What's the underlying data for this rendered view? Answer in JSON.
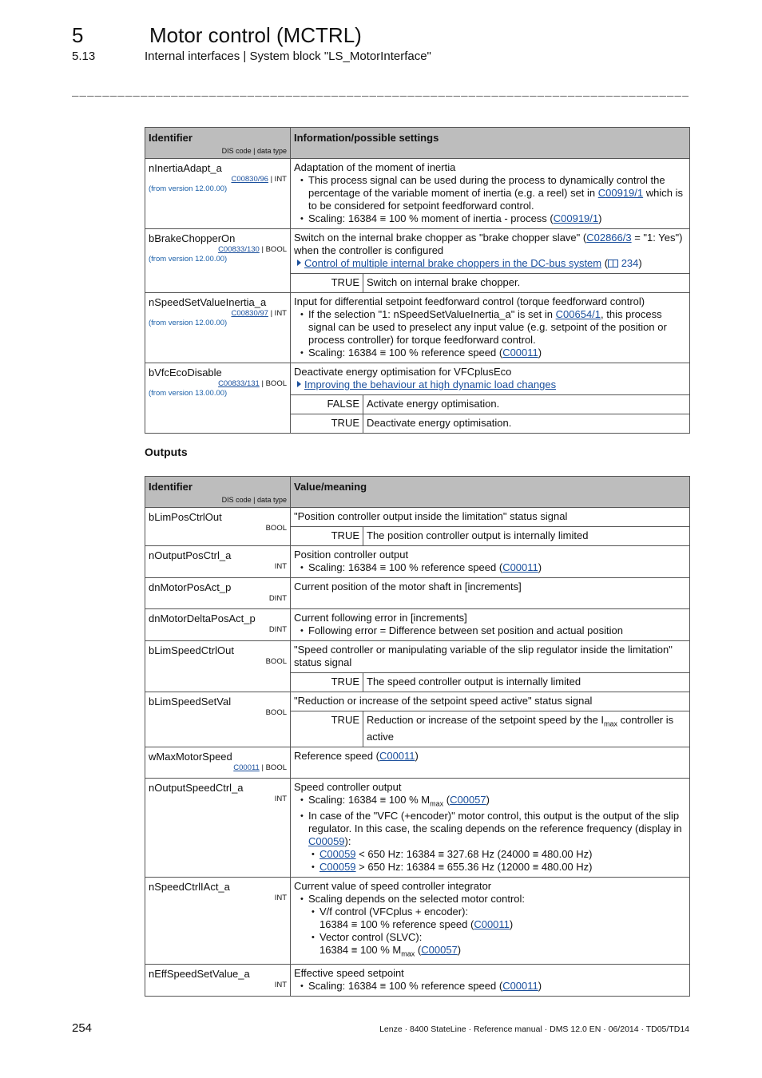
{
  "header": {
    "chapter_number": "5",
    "chapter_title": "Motor control (MCTRL)",
    "section_number": "5.13",
    "section_title": "Internal interfaces | System block \"LS_MotorInterface\"",
    "rule": "_______________________________________________________________________________________________"
  },
  "inputs_table": {
    "col_identifier": "Identifier",
    "col_identifier_sub": "DIS code | data type",
    "col_info": "Information/possible settings",
    "rows": [
      {
        "name": "nInertiaAdapt_a",
        "code": "C00830/96",
        "type": " | INT",
        "version": "(from version 12.00.00)",
        "desc": "Adaptation of the moment of inertia",
        "b1_pre": "This process signal can be used during the process to dynamically control the percentage of the variable moment of inertia (e.g. a reel) set in ",
        "b1_link": "C00919/1",
        "b1_post": " which is to be considered for setpoint feedforward control.",
        "b2_pre": "Scaling: 16384 ≡ 100 % moment of inertia - process (",
        "b2_link": "C00919/1",
        "b2_post": ")"
      },
      {
        "name": "bBrakeChopperOn",
        "code": "C00833/130",
        "type": " | BOOL",
        "version": "(from version 12.00.00)",
        "desc_pre": "Switch on the internal brake chopper as \"brake chopper slave\" (",
        "desc_link": "C02866/3",
        "desc_post": " = \"1: Yes\") when the controller is configured",
        "xref_text": "Control of multiple internal brake choppers in the DC-bus system",
        "xref_page": "234",
        "values": [
          {
            "key": "TRUE",
            "text": "Switch on internal brake chopper."
          }
        ]
      },
      {
        "name": "nSpeedSetValueInertia_a",
        "code": "C00830/97",
        "type": " | INT",
        "version": "(from version 12.00.00)",
        "desc": "Input for differential setpoint feedforward control (torque feedforward control)",
        "b1_pre": "If the selection \"1: nSpeedSetValueInertia_a\" is set in ",
        "b1_link": "C00654/1",
        "b1_post": ", this process signal can be used to preselect any input value (e.g. setpoint of the position or process controller) for torque feedforward control.",
        "b2_pre": "Scaling: 16384 ≡ 100 % reference speed (",
        "b2_link": "C00011",
        "b2_post": ")"
      },
      {
        "name": "bVfcEcoDisable",
        "code": "C00833/131",
        "type": " | BOOL",
        "version": "(from version 13.00.00)",
        "desc": "Deactivate energy optimisation for VFCplusEco",
        "xref_text": "Improving the behaviour at high dynamic load changes",
        "values": [
          {
            "key": "FALSE",
            "text": "Activate energy optimisation."
          },
          {
            "key": "TRUE",
            "text": "Deactivate energy optimisation."
          }
        ]
      }
    ]
  },
  "outputs_heading": "Outputs",
  "outputs_table": {
    "col_identifier": "Identifier",
    "col_identifier_sub": "DIS code | data type",
    "col_info": "Value/meaning",
    "rows": [
      {
        "name": "bLimPosCtrlOut",
        "type": "BOOL",
        "desc": "\"Position controller output inside the limitation\" status signal",
        "values": [
          {
            "key": "TRUE",
            "text": "The position controller output is internally limited"
          }
        ]
      },
      {
        "name": "nOutputPosCtrl_a",
        "type": "INT",
        "desc": "Position controller output",
        "b1_pre": "Scaling: 16384 ≡ 100 % reference speed (",
        "b1_link": "C00011",
        "b1_post": ")"
      },
      {
        "name": "dnMotorPosAct_p",
        "type": "DINT",
        "desc": "Current position of the motor shaft in [increments]"
      },
      {
        "name": "dnMotorDeltaPosAct_p",
        "type": "DINT",
        "desc": "Current following error in [increments]",
        "b1": "Following error = Difference between set position and actual position"
      },
      {
        "name": "bLimSpeedCtrlOut",
        "type": "BOOL",
        "desc": "\"Speed controller or manipulating variable of the slip regulator inside the limitation\" status signal",
        "values": [
          {
            "key": "TRUE",
            "text": "The speed controller output is internally limited"
          }
        ]
      },
      {
        "name": "bLimSpeedSetVal",
        "type": "BOOL",
        "desc": "\"Reduction or increase of the setpoint speed active\" status signal",
        "values": [
          {
            "key": "TRUE",
            "text_pre": "Reduction or increase of the setpoint speed by the I",
            "text_sub": "max",
            "text_post": " controller is active"
          }
        ]
      },
      {
        "name": "wMaxMotorSpeed",
        "code": "C00011",
        "type": " | BOOL",
        "desc_pre": "Reference speed (",
        "desc_link": "C00011",
        "desc_post": ")"
      },
      {
        "name": "nOutputSpeedCtrl_a",
        "type": "INT",
        "desc": "Speed controller output",
        "b1_pre": "Scaling: 16384 ≡ 100 % M",
        "b1_sub": "max",
        "b1_mid": " (",
        "b1_link": "C00057",
        "b1_post": ")",
        "b2_pre": "In case of the \"VFC (+encoder)\" motor control, this output is the output of the slip regulator. In this case, the scaling depends on the reference frequency (display in ",
        "b2_link": "C00059",
        "b2_post": "):",
        "sub1_link": "C00059",
        "sub1_text": " < 650 Hz: 16384 ≡ 327.68 Hz (24000 ≡ 480.00 Hz)",
        "sub2_link": "C00059",
        "sub2_text": " > 650 Hz: 16384 ≡ 655.36 Hz (12000 ≡ 480.00 Hz)"
      },
      {
        "name": "nSpeedCtrlIAct_a",
        "type": "INT",
        "desc": "Current value of speed controller integrator",
        "b1": "Scaling depends on the selected motor control:",
        "sub1_line1": "V/f control (VFCplus + encoder):",
        "sub1_line2_pre": "16384 ≡ 100 % reference speed (",
        "sub1_link": "C00011",
        "sub1_post": ")",
        "sub2_line1": "Vector control (SLVC):",
        "sub2_line2_pre": "16384 ≡ 100 % M",
        "sub2_sub": "max",
        "sub2_mid": " (",
        "sub2_link": "C00057",
        "sub2_post": ")"
      },
      {
        "name": "nEffSpeedSetValue_a",
        "type": "INT",
        "desc": "Effective speed setpoint",
        "b1_pre": "Scaling: 16384 ≡ 100 % reference speed (",
        "b1_link": "C00011",
        "b1_post": ")"
      }
    ]
  },
  "footer": {
    "page_number": "254",
    "text": "Lenze · 8400 StateLine · Reference manual · DMS 12.0 EN · 06/2014 · TD05/TD14"
  }
}
